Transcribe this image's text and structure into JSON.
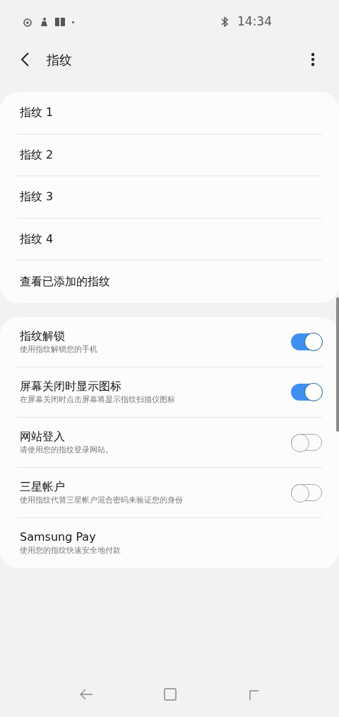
{
  "status_bar": {
    "time": "14:34"
  },
  "header": {
    "title": "指纹"
  },
  "fingerprints": [
    {
      "label": "指纹 1"
    },
    {
      "label": "指纹 2"
    },
    {
      "label": "指纹 3"
    },
    {
      "label": "指纹 4"
    },
    {
      "label": "查看已添加的指纹"
    }
  ],
  "settings": [
    {
      "kind": "toggle",
      "title": "指纹解锁",
      "subtitle": "使用指纹解锁您的手机",
      "on": true
    },
    {
      "kind": "toggle",
      "title": "屏幕关闭时显示图标",
      "subtitle": "在屏幕关闭时点击屏幕将显示指纹扫描仪图标",
      "on": true
    },
    {
      "kind": "toggle",
      "title": "网站登入",
      "subtitle": "请使用您的指纹登录网站。",
      "on": false
    },
    {
      "kind": "toggle",
      "title": "三星帐户",
      "subtitle": "使用指纹代替三星帐户混合密码来验证您的身份",
      "on": false
    },
    {
      "kind": "link",
      "title": "Samsung Pay",
      "subtitle": "使用您的指纹快速安全地付款"
    }
  ]
}
